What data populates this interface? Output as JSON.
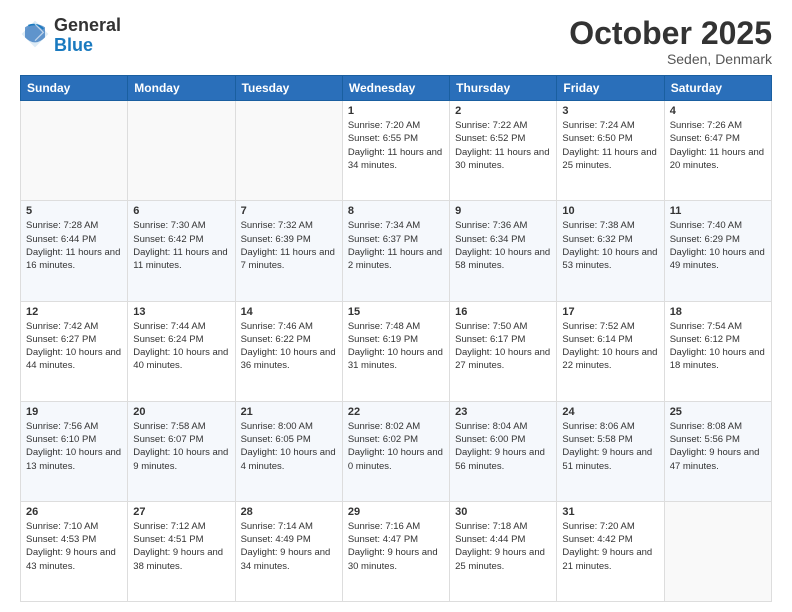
{
  "header": {
    "logo_general": "General",
    "logo_blue": "Blue",
    "month_title": "October 2025",
    "location": "Seden, Denmark"
  },
  "days_of_week": [
    "Sunday",
    "Monday",
    "Tuesday",
    "Wednesday",
    "Thursday",
    "Friday",
    "Saturday"
  ],
  "weeks": [
    [
      {
        "day": "",
        "info": ""
      },
      {
        "day": "",
        "info": ""
      },
      {
        "day": "",
        "info": ""
      },
      {
        "day": "1",
        "info": "Sunrise: 7:20 AM\nSunset: 6:55 PM\nDaylight: 11 hours\nand 34 minutes."
      },
      {
        "day": "2",
        "info": "Sunrise: 7:22 AM\nSunset: 6:52 PM\nDaylight: 11 hours\nand 30 minutes."
      },
      {
        "day": "3",
        "info": "Sunrise: 7:24 AM\nSunset: 6:50 PM\nDaylight: 11 hours\nand 25 minutes."
      },
      {
        "day": "4",
        "info": "Sunrise: 7:26 AM\nSunset: 6:47 PM\nDaylight: 11 hours\nand 20 minutes."
      }
    ],
    [
      {
        "day": "5",
        "info": "Sunrise: 7:28 AM\nSunset: 6:44 PM\nDaylight: 11 hours\nand 16 minutes."
      },
      {
        "day": "6",
        "info": "Sunrise: 7:30 AM\nSunset: 6:42 PM\nDaylight: 11 hours\nand 11 minutes."
      },
      {
        "day": "7",
        "info": "Sunrise: 7:32 AM\nSunset: 6:39 PM\nDaylight: 11 hours\nand 7 minutes."
      },
      {
        "day": "8",
        "info": "Sunrise: 7:34 AM\nSunset: 6:37 PM\nDaylight: 11 hours\nand 2 minutes."
      },
      {
        "day": "9",
        "info": "Sunrise: 7:36 AM\nSunset: 6:34 PM\nDaylight: 10 hours\nand 58 minutes."
      },
      {
        "day": "10",
        "info": "Sunrise: 7:38 AM\nSunset: 6:32 PM\nDaylight: 10 hours\nand 53 minutes."
      },
      {
        "day": "11",
        "info": "Sunrise: 7:40 AM\nSunset: 6:29 PM\nDaylight: 10 hours\nand 49 minutes."
      }
    ],
    [
      {
        "day": "12",
        "info": "Sunrise: 7:42 AM\nSunset: 6:27 PM\nDaylight: 10 hours\nand 44 minutes."
      },
      {
        "day": "13",
        "info": "Sunrise: 7:44 AM\nSunset: 6:24 PM\nDaylight: 10 hours\nand 40 minutes."
      },
      {
        "day": "14",
        "info": "Sunrise: 7:46 AM\nSunset: 6:22 PM\nDaylight: 10 hours\nand 36 minutes."
      },
      {
        "day": "15",
        "info": "Sunrise: 7:48 AM\nSunset: 6:19 PM\nDaylight: 10 hours\nand 31 minutes."
      },
      {
        "day": "16",
        "info": "Sunrise: 7:50 AM\nSunset: 6:17 PM\nDaylight: 10 hours\nand 27 minutes."
      },
      {
        "day": "17",
        "info": "Sunrise: 7:52 AM\nSunset: 6:14 PM\nDaylight: 10 hours\nand 22 minutes."
      },
      {
        "day": "18",
        "info": "Sunrise: 7:54 AM\nSunset: 6:12 PM\nDaylight: 10 hours\nand 18 minutes."
      }
    ],
    [
      {
        "day": "19",
        "info": "Sunrise: 7:56 AM\nSunset: 6:10 PM\nDaylight: 10 hours\nand 13 minutes."
      },
      {
        "day": "20",
        "info": "Sunrise: 7:58 AM\nSunset: 6:07 PM\nDaylight: 10 hours\nand 9 minutes."
      },
      {
        "day": "21",
        "info": "Sunrise: 8:00 AM\nSunset: 6:05 PM\nDaylight: 10 hours\nand 4 minutes."
      },
      {
        "day": "22",
        "info": "Sunrise: 8:02 AM\nSunset: 6:02 PM\nDaylight: 10 hours\nand 0 minutes."
      },
      {
        "day": "23",
        "info": "Sunrise: 8:04 AM\nSunset: 6:00 PM\nDaylight: 9 hours\nand 56 minutes."
      },
      {
        "day": "24",
        "info": "Sunrise: 8:06 AM\nSunset: 5:58 PM\nDaylight: 9 hours\nand 51 minutes."
      },
      {
        "day": "25",
        "info": "Sunrise: 8:08 AM\nSunset: 5:56 PM\nDaylight: 9 hours\nand 47 minutes."
      }
    ],
    [
      {
        "day": "26",
        "info": "Sunrise: 7:10 AM\nSunset: 4:53 PM\nDaylight: 9 hours\nand 43 minutes."
      },
      {
        "day": "27",
        "info": "Sunrise: 7:12 AM\nSunset: 4:51 PM\nDaylight: 9 hours\nand 38 minutes."
      },
      {
        "day": "28",
        "info": "Sunrise: 7:14 AM\nSunset: 4:49 PM\nDaylight: 9 hours\nand 34 minutes."
      },
      {
        "day": "29",
        "info": "Sunrise: 7:16 AM\nSunset: 4:47 PM\nDaylight: 9 hours\nand 30 minutes."
      },
      {
        "day": "30",
        "info": "Sunrise: 7:18 AM\nSunset: 4:44 PM\nDaylight: 9 hours\nand 25 minutes."
      },
      {
        "day": "31",
        "info": "Sunrise: 7:20 AM\nSunset: 4:42 PM\nDaylight: 9 hours\nand 21 minutes."
      },
      {
        "day": "",
        "info": ""
      }
    ]
  ]
}
